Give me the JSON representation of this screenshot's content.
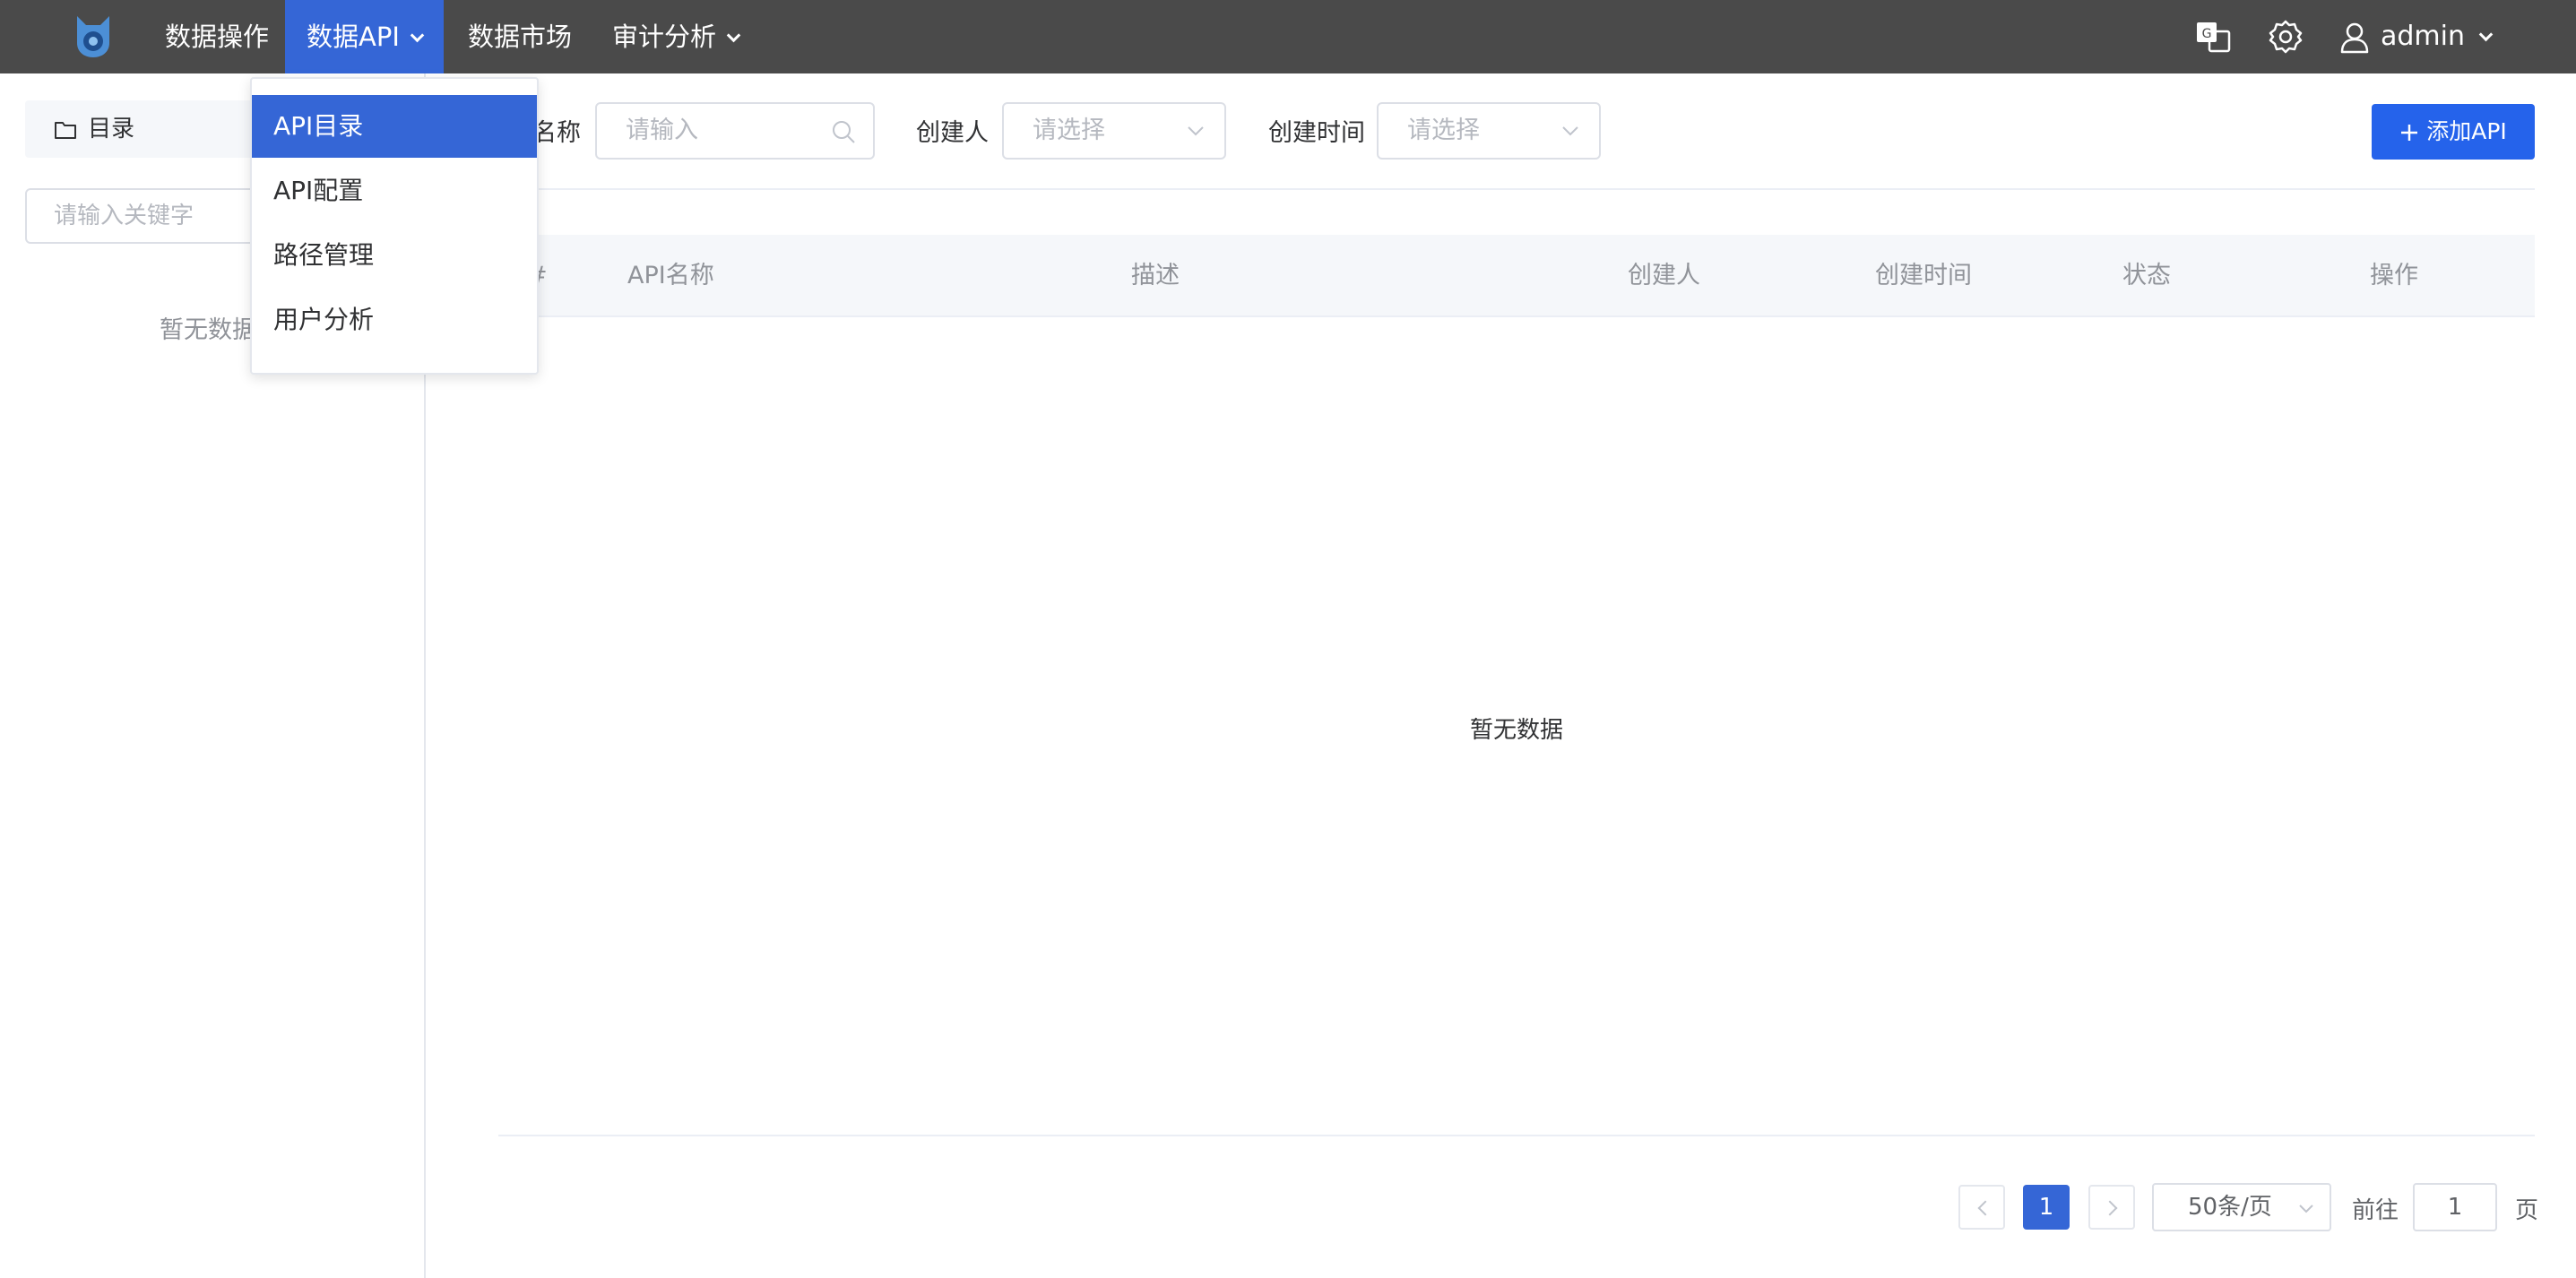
{
  "colors": {
    "topbar": "#4a4a4a",
    "accent": "#3566d6",
    "primary_button": "#2563eb"
  },
  "nav": {
    "items": [
      {
        "label": "数据操作",
        "has_dropdown": false
      },
      {
        "label": "数据API",
        "has_dropdown": true,
        "active": true
      },
      {
        "label": "数据市场",
        "has_dropdown": false
      },
      {
        "label": "审计分析",
        "has_dropdown": true
      }
    ],
    "icons": [
      "translate-icon",
      "settings-gear-icon",
      "user-icon"
    ],
    "user": {
      "name": "admin"
    }
  },
  "dropdown": {
    "items": [
      {
        "label": "API目录",
        "active": true
      },
      {
        "label": "API配置"
      },
      {
        "label": "路径管理"
      },
      {
        "label": "用户分析"
      }
    ]
  },
  "sidebar": {
    "header": "目录",
    "search_placeholder": "请输入关键字",
    "empty_text": "暂无数据"
  },
  "filters": {
    "name_label": "API名称",
    "name_placeholder": "请输入",
    "creator_label": "创建人",
    "creator_placeholder": "请选择",
    "created_time_label": "创建时间",
    "created_time_placeholder": "请选择"
  },
  "add_button": "添加API",
  "table": {
    "columns": [
      "#",
      "API名称",
      "描述",
      "创建人",
      "创建时间",
      "状态",
      "操作"
    ],
    "rows": [],
    "empty_text": "暂无数据"
  },
  "pagination": {
    "current_page": "1",
    "page_size": "50条/页",
    "goto_prefix": "前往",
    "goto_value": "1",
    "goto_suffix": "页"
  }
}
